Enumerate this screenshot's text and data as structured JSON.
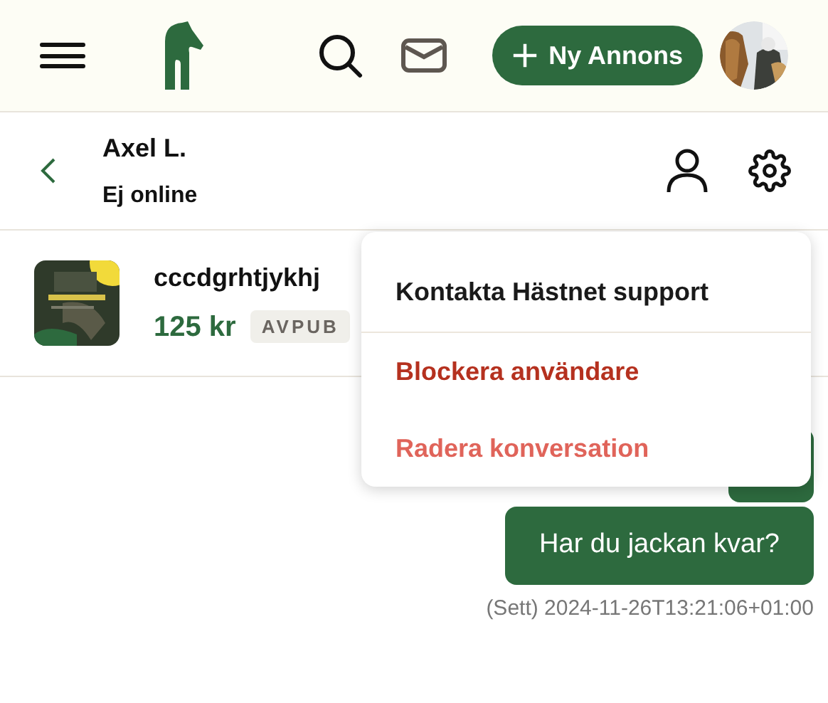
{
  "header": {
    "new_ad_button": "Ny Annons"
  },
  "chat_header": {
    "name": "Axel L.",
    "status": "Ej online"
  },
  "listing": {
    "title": "cccdgrhtjykhj",
    "price": "125 kr",
    "badge": "AVPUB"
  },
  "menu": {
    "items": [
      {
        "label": "Kontakta Hästnet support",
        "kind": "neutral"
      },
      {
        "label": "Blockera användare",
        "kind": "danger"
      },
      {
        "label": "Radera konversation",
        "kind": "destructive"
      }
    ]
  },
  "messages": [
    {
      "text": "Har du jackan kvar?",
      "meta": "(Sett) 2024-11-26T13:21:06+01:00"
    }
  ]
}
